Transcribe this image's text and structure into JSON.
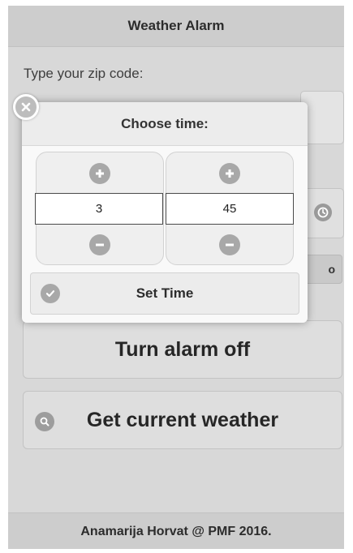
{
  "app": {
    "title": "Weather Alarm",
    "footer": "Anamarija Horvat @ PMF 2016."
  },
  "form": {
    "zip_label": "Type your zip code:",
    "go_label": "o"
  },
  "buttons": {
    "alarm_off": "Turn alarm off",
    "get_weather": "Get current weather"
  },
  "popup": {
    "title": "Choose time:",
    "hours_value": "3",
    "minutes_value": "45",
    "set_label": "Set Time"
  },
  "icons": {
    "close": "close-icon",
    "plus": "plus-icon",
    "minus": "minus-icon",
    "check": "check-icon",
    "clock": "clock-icon",
    "search": "search-icon"
  }
}
